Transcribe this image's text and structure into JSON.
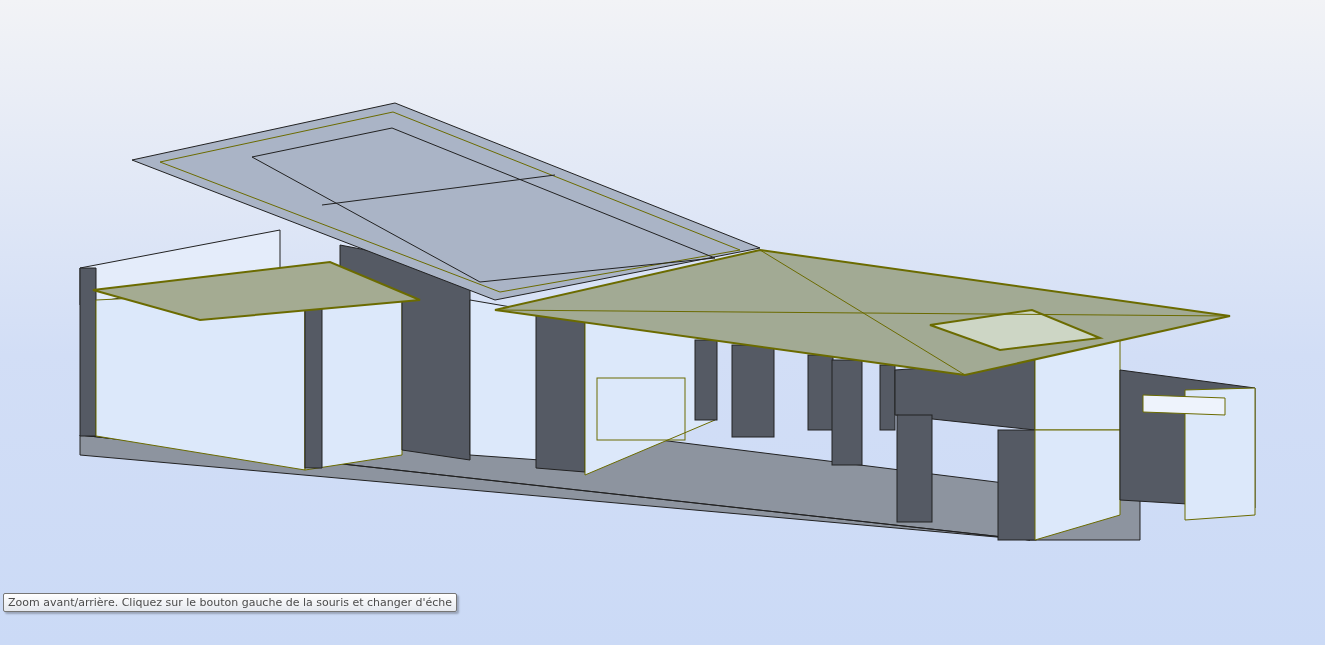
{
  "tooltip": {
    "text": "Zoom avant/arrière. Cliquez sur le bouton gauche de la souris et changer d'éche"
  }
}
